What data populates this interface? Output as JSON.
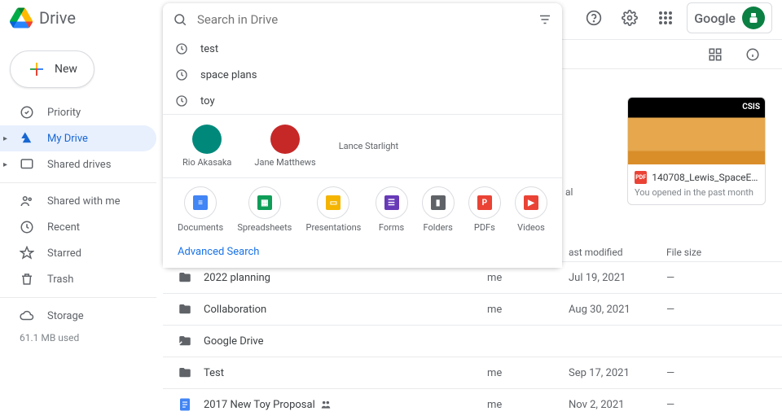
{
  "header": {
    "brand": "Drive",
    "search_placeholder": "Search in Drive",
    "google_label": "Google"
  },
  "search_dropdown": {
    "recent": [
      "test",
      "space plans",
      "toy"
    ],
    "people": [
      {
        "name": "Rio Akasaka"
      },
      {
        "name": "Jane Matthews"
      },
      {
        "name": "Lance Starlight"
      }
    ],
    "filetypes": [
      {
        "label": "Documents",
        "color": "#4285f4"
      },
      {
        "label": "Spreadsheets",
        "color": "#0f9d58"
      },
      {
        "label": "Presentations",
        "color": "#f4b400"
      },
      {
        "label": "Forms",
        "color": "#673ab7"
      },
      {
        "label": "Folders",
        "color": "#5f6368"
      },
      {
        "label": "PDFs",
        "color": "#ea4335"
      },
      {
        "label": "Videos",
        "color": "#ea4335"
      }
    ],
    "advanced_label": "Advanced Search"
  },
  "sidebar": {
    "new_label": "New",
    "items": [
      {
        "label": "Priority"
      },
      {
        "label": "My Drive"
      },
      {
        "label": "Shared drives"
      },
      {
        "label": "Shared with me"
      },
      {
        "label": "Recent"
      },
      {
        "label": "Starred"
      },
      {
        "label": "Trash"
      },
      {
        "label": "Storage"
      }
    ],
    "storage_used": "61.1 MB used"
  },
  "columns": {
    "owner_partial": "",
    "modified": "ast modified",
    "size": "File size"
  },
  "card": {
    "badge": "CSIS",
    "title": "140708_Lewis_SpaceEx...",
    "subtitle": "You opened in the past month",
    "pdf": "PDF"
  },
  "files": [
    {
      "type": "folder",
      "name": "2022 planning",
      "owner": "me",
      "modified": "Jul 19, 2021",
      "size": "—"
    },
    {
      "type": "folder",
      "name": "Collaboration",
      "owner": "me",
      "modified": "Aug 30, 2021",
      "size": "—"
    },
    {
      "type": "shortcut",
      "name": "Google Drive",
      "owner": "",
      "modified": "",
      "size": ""
    },
    {
      "type": "folder",
      "name": "Test",
      "owner": "me",
      "modified": "Sep 17, 2021",
      "size": "—"
    },
    {
      "type": "doc",
      "name": "2017 New Toy Proposal",
      "owner": "me",
      "modified": "Nov 2, 2021",
      "size": "—",
      "shared": true
    }
  ],
  "visible_text_fragments": {
    "partial_al": "al"
  }
}
